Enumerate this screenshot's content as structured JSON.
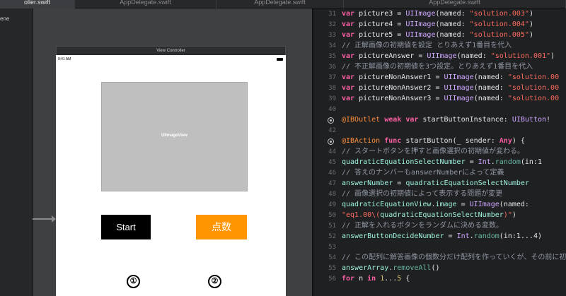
{
  "tabs": [
    {
      "label": "oller.swift",
      "active": true
    },
    {
      "label": "AppDelegate.swift",
      "active": false
    },
    {
      "label": "AppDelegate.swift",
      "active": false
    },
    {
      "label": "AppDelegate.swift",
      "active": false
    }
  ],
  "navigator": {
    "scene_label": "ene"
  },
  "storyboard": {
    "vc_title": "View Controller",
    "status_time": "9:41 AM",
    "imageview_label": "UIImageView",
    "start_button": "Start",
    "score_button": "点数",
    "choice1": "①",
    "choice2": "②"
  },
  "colors": {
    "accent_orange": "#ff9500",
    "keyword": "#fc5fa3",
    "string": "#fc6a5d",
    "comment": "#8f97a3"
  },
  "code_lines": [
    {
      "num": "31",
      "marker": false,
      "tokens": [
        {
          "c": "kw",
          "t": "var "
        },
        {
          "c": "pl",
          "t": "picture3 = "
        },
        {
          "c": "ty",
          "t": "UIImage"
        },
        {
          "c": "pl",
          "t": "(named: "
        },
        {
          "c": "str",
          "t": "\"solution.003\""
        },
        {
          "c": "pl",
          "t": ")"
        }
      ]
    },
    {
      "num": "32",
      "marker": false,
      "tokens": [
        {
          "c": "kw",
          "t": "var "
        },
        {
          "c": "pl",
          "t": "picture4 = "
        },
        {
          "c": "ty",
          "t": "UIImage"
        },
        {
          "c": "pl",
          "t": "(named: "
        },
        {
          "c": "str",
          "t": "\"solution.004\""
        },
        {
          "c": "pl",
          "t": ")"
        }
      ]
    },
    {
      "num": "33",
      "marker": false,
      "tokens": [
        {
          "c": "kw",
          "t": "var "
        },
        {
          "c": "pl",
          "t": "picture5 = "
        },
        {
          "c": "ty",
          "t": "UIImage"
        },
        {
          "c": "pl",
          "t": "(named: "
        },
        {
          "c": "str",
          "t": "\"solution.005\""
        },
        {
          "c": "pl",
          "t": ")"
        }
      ]
    },
    {
      "num": "34",
      "marker": false,
      "tokens": [
        {
          "c": "cm",
          "t": "//    正解画像の初期値を設定 とりあえず1番目を代入"
        }
      ]
    },
    {
      "num": "35",
      "marker": false,
      "tokens": [
        {
          "c": "kw",
          "t": "var "
        },
        {
          "c": "pl",
          "t": "pictureAnswer = "
        },
        {
          "c": "ty",
          "t": "UIImage"
        },
        {
          "c": "pl",
          "t": "(named: "
        },
        {
          "c": "str",
          "t": "\"solution.001\""
        },
        {
          "c": "pl",
          "t": ")"
        }
      ]
    },
    {
      "num": "36",
      "marker": false,
      "tokens": [
        {
          "c": "cm",
          "t": "//    不正解画像の初期値を3つ設定。とりあえず1番目を代入"
        }
      ]
    },
    {
      "num": "37",
      "marker": false,
      "tokens": [
        {
          "c": "kw",
          "t": "var "
        },
        {
          "c": "pl",
          "t": "pictureNonAnswer1 = "
        },
        {
          "c": "ty",
          "t": "UIImage"
        },
        {
          "c": "pl",
          "t": "(named: "
        },
        {
          "c": "str",
          "t": "\"solution.00"
        }
      ]
    },
    {
      "num": "38",
      "marker": false,
      "tokens": [
        {
          "c": "kw",
          "t": "var "
        },
        {
          "c": "pl",
          "t": "pictureNonAnswer2 = "
        },
        {
          "c": "ty",
          "t": "UIImage"
        },
        {
          "c": "pl",
          "t": "(named: "
        },
        {
          "c": "str",
          "t": "\"solution.00"
        }
      ]
    },
    {
      "num": "39",
      "marker": false,
      "tokens": [
        {
          "c": "kw",
          "t": "var "
        },
        {
          "c": "pl",
          "t": "pictureNonAnswer3 = "
        },
        {
          "c": "ty",
          "t": "UIImage"
        },
        {
          "c": "pl",
          "t": "(named: "
        },
        {
          "c": "str",
          "t": "\"solution.00"
        }
      ]
    },
    {
      "num": "40",
      "marker": false,
      "tokens": []
    },
    {
      "num": "",
      "marker": true,
      "tokens": [
        {
          "c": "at",
          "t": "@IBOutlet "
        },
        {
          "c": "kw",
          "t": "weak var "
        },
        {
          "c": "pl",
          "t": "startButtonInstance: "
        },
        {
          "c": "ty",
          "t": "UIButton"
        },
        {
          "c": "pl",
          "t": "!"
        }
      ]
    },
    {
      "num": "42",
      "marker": false,
      "tokens": []
    },
    {
      "num": "",
      "marker": true,
      "tokens": [
        {
          "c": "at",
          "t": "@IBAction "
        },
        {
          "c": "kw",
          "t": "func "
        },
        {
          "c": "pl",
          "t": "startButton(_ sender: "
        },
        {
          "c": "kw",
          "t": "Any"
        },
        {
          "c": "pl",
          "t": ") {"
        }
      ]
    },
    {
      "num": "44",
      "marker": false,
      "tokens": [
        {
          "c": "cm",
          "t": "//        スタートボタンを押すと画像選択の初期値が変わる。"
        }
      ]
    },
    {
      "num": "45",
      "marker": false,
      "tokens": [
        {
          "c": "pl",
          "t": "        "
        },
        {
          "c": "id",
          "t": "quadraticEquationSelectNumber"
        },
        {
          "c": "pl",
          "t": " = "
        },
        {
          "c": "ty",
          "t": "Int"
        },
        {
          "c": "pl",
          "t": "."
        },
        {
          "c": "fn",
          "t": "random"
        },
        {
          "c": "pl",
          "t": "(in:1"
        }
      ]
    },
    {
      "num": "46",
      "marker": false,
      "tokens": [
        {
          "c": "cm",
          "t": "//        答えのナンバーもanswerNumberによって定義"
        }
      ]
    },
    {
      "num": "47",
      "marker": false,
      "tokens": [
        {
          "c": "pl",
          "t": "        "
        },
        {
          "c": "id",
          "t": "answerNumber"
        },
        {
          "c": "pl",
          "t": " = "
        },
        {
          "c": "id",
          "t": "quadraticEquationSelectNumber"
        }
      ]
    },
    {
      "num": "48",
      "marker": false,
      "tokens": [
        {
          "c": "cm",
          "t": "//        画像選択の初期値によって表示する問題が変更"
        }
      ]
    },
    {
      "num": "49",
      "marker": false,
      "tokens": [
        {
          "c": "pl",
          "t": "        "
        },
        {
          "c": "id",
          "t": "quadraticEquationView"
        },
        {
          "c": "pl",
          "t": "."
        },
        {
          "c": "id",
          "t": "image"
        },
        {
          "c": "pl",
          "t": " = "
        },
        {
          "c": "ty",
          "t": "UIImage"
        },
        {
          "c": "pl",
          "t": "(named:"
        }
      ]
    },
    {
      "num": "50",
      "marker": false,
      "tokens": [
        {
          "c": "pl",
          "t": "            "
        },
        {
          "c": "str",
          "t": "\"eq1.00\\("
        },
        {
          "c": "id",
          "t": "quadraticEquationSelectNumber"
        },
        {
          "c": "str",
          "t": ")\""
        },
        {
          "c": "pl",
          "t": ")"
        }
      ]
    },
    {
      "num": "51",
      "marker": false,
      "tokens": [
        {
          "c": "cm",
          "t": "//    正解を入れるボタンをランダムに決める変数。"
        }
      ]
    },
    {
      "num": "52",
      "marker": false,
      "tokens": [
        {
          "c": "pl",
          "t": "        "
        },
        {
          "c": "id",
          "t": "answerButtonDecideNumber"
        },
        {
          "c": "pl",
          "t": " = "
        },
        {
          "c": "ty",
          "t": "Int"
        },
        {
          "c": "pl",
          "t": "."
        },
        {
          "c": "fn",
          "t": "random"
        },
        {
          "c": "pl",
          "t": "(in:1...4)"
        }
      ]
    },
    {
      "num": "53",
      "marker": false,
      "tokens": []
    },
    {
      "num": "54",
      "marker": false,
      "tokens": [
        {
          "c": "cm",
          "t": "//    この配列に解答画像の個数分だけ配列を作っていくが、その前に初"
        }
      ]
    },
    {
      "num": "55",
      "marker": false,
      "tokens": [
        {
          "c": "pl",
          "t": "        "
        },
        {
          "c": "id",
          "t": "answerArray"
        },
        {
          "c": "pl",
          "t": "."
        },
        {
          "c": "fn",
          "t": "removeAll"
        },
        {
          "c": "pl",
          "t": "()"
        }
      ]
    },
    {
      "num": "56",
      "marker": false,
      "tokens": [
        {
          "c": "pl",
          "t": "        "
        },
        {
          "c": "kw",
          "t": "for "
        },
        {
          "c": "pl",
          "t": "n "
        },
        {
          "c": "kw",
          "t": "in "
        },
        {
          "c": "num",
          "t": "1"
        },
        {
          "c": "pl",
          "t": "..."
        },
        {
          "c": "num",
          "t": "5"
        },
        {
          "c": "pl",
          "t": " {"
        }
      ]
    }
  ]
}
